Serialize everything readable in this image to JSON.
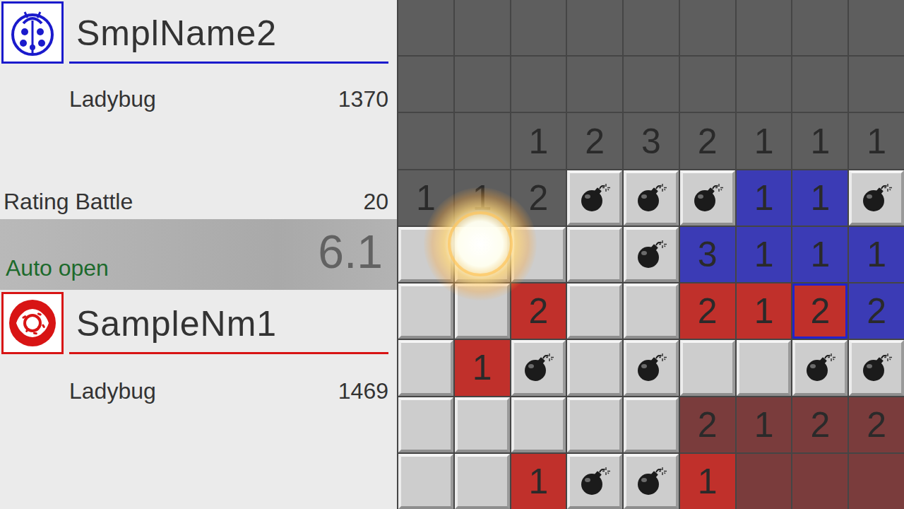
{
  "players": [
    {
      "name": "SmplName2",
      "title": "Ladybug",
      "rating": "1370",
      "color": "#1a1acc",
      "kind": "ladybug"
    },
    {
      "name": "SampleNm1",
      "title": "Ladybug",
      "rating": "1469",
      "color": "#d81414",
      "kind": "donut"
    }
  ],
  "mode": {
    "label": "Rating Battle",
    "value": "20"
  },
  "timer": {
    "value": "6.1"
  },
  "auto_open": {
    "label": "Auto open"
  },
  "board": {
    "rows": [
      [
        {
          "kind": "open",
          "number": "",
          "color": "#5e5e5e",
          "selected": false
        },
        {
          "kind": "open",
          "number": "",
          "color": "#5e5e5e",
          "selected": false
        },
        {
          "kind": "open",
          "number": "",
          "color": "#5e5e5e",
          "selected": false
        },
        {
          "kind": "open",
          "number": "",
          "color": "#5e5e5e",
          "selected": false
        },
        {
          "kind": "open",
          "number": "",
          "color": "#5e5e5e",
          "selected": false
        },
        {
          "kind": "open",
          "number": "",
          "color": "#5e5e5e",
          "selected": false
        },
        {
          "kind": "open",
          "number": "",
          "color": "#5e5e5e",
          "selected": false
        },
        {
          "kind": "open",
          "number": "",
          "color": "#5e5e5e",
          "selected": false
        },
        {
          "kind": "open",
          "number": "",
          "color": "#5e5e5e",
          "selected": false
        }
      ],
      [
        {
          "kind": "open",
          "number": "",
          "color": "#5e5e5e",
          "selected": false
        },
        {
          "kind": "open",
          "number": "",
          "color": "#5e5e5e",
          "selected": false
        },
        {
          "kind": "open",
          "number": "",
          "color": "#5e5e5e",
          "selected": false
        },
        {
          "kind": "open",
          "number": "",
          "color": "#5e5e5e",
          "selected": false
        },
        {
          "kind": "open",
          "number": "",
          "color": "#5e5e5e",
          "selected": false
        },
        {
          "kind": "open",
          "number": "",
          "color": "#5e5e5e",
          "selected": false
        },
        {
          "kind": "open",
          "number": "",
          "color": "#5e5e5e",
          "selected": false
        },
        {
          "kind": "open",
          "number": "",
          "color": "#5e5e5e",
          "selected": false
        },
        {
          "kind": "open",
          "number": "",
          "color": "#5e5e5e",
          "selected": false
        }
      ],
      [
        {
          "kind": "open",
          "number": "",
          "color": "#5e5e5e",
          "selected": false
        },
        {
          "kind": "open",
          "number": "",
          "color": "#5e5e5e",
          "selected": false
        },
        {
          "kind": "open",
          "number": "1",
          "color": "#5e5e5e",
          "selected": false
        },
        {
          "kind": "open",
          "number": "2",
          "color": "#5e5e5e",
          "selected": false
        },
        {
          "kind": "open",
          "number": "3",
          "color": "#5e5e5e",
          "selected": false
        },
        {
          "kind": "open",
          "number": "2",
          "color": "#5e5e5e",
          "selected": false
        },
        {
          "kind": "open",
          "number": "1",
          "color": "#5e5e5e",
          "selected": false
        },
        {
          "kind": "open",
          "number": "1",
          "color": "#5e5e5e",
          "selected": false
        },
        {
          "kind": "open",
          "number": "1",
          "color": "#5e5e5e",
          "selected": false
        }
      ],
      [
        {
          "kind": "open",
          "number": "1",
          "color": "#5e5e5e",
          "selected": false
        },
        {
          "kind": "open",
          "number": "1",
          "color": "#5e5e5e",
          "selected": false
        },
        {
          "kind": "open",
          "number": "2",
          "color": "#5e5e5e",
          "selected": false
        },
        {
          "kind": "mine",
          "selected": false
        },
        {
          "kind": "mine",
          "selected": false
        },
        {
          "kind": "mine",
          "selected": false
        },
        {
          "kind": "open",
          "number": "1",
          "color": "#3b3bb5",
          "selected": false
        },
        {
          "kind": "open",
          "number": "1",
          "color": "#3b3bb5",
          "selected": false
        },
        {
          "kind": "mine",
          "selected": false
        }
      ],
      [
        {
          "kind": "closed",
          "selected": false
        },
        {
          "kind": "closed",
          "selected": false
        },
        {
          "kind": "closed",
          "selected": false
        },
        {
          "kind": "closed",
          "selected": false
        },
        {
          "kind": "mine",
          "selected": false
        },
        {
          "kind": "open",
          "number": "3",
          "color": "#3b3bb5",
          "selected": false
        },
        {
          "kind": "open",
          "number": "1",
          "color": "#3b3bb5",
          "selected": false
        },
        {
          "kind": "open",
          "number": "1",
          "color": "#3b3bb5",
          "selected": false
        },
        {
          "kind": "open",
          "number": "1",
          "color": "#3b3bb5",
          "selected": false
        }
      ],
      [
        {
          "kind": "closed",
          "selected": false
        },
        {
          "kind": "closed",
          "selected": false
        },
        {
          "kind": "open",
          "number": "2",
          "color": "#c0302b",
          "selected": false
        },
        {
          "kind": "closed",
          "selected": false
        },
        {
          "kind": "closed",
          "selected": false
        },
        {
          "kind": "open",
          "number": "2",
          "color": "#c0302b",
          "selected": false
        },
        {
          "kind": "open",
          "number": "1",
          "color": "#c0302b",
          "selected": false
        },
        {
          "kind": "open",
          "number": "2",
          "color": "#c0302b",
          "selected": true
        },
        {
          "kind": "open",
          "number": "2",
          "color": "#3b3bb5",
          "selected": false
        }
      ],
      [
        {
          "kind": "closed",
          "selected": false
        },
        {
          "kind": "open",
          "number": "1",
          "color": "#c0302b",
          "selected": false
        },
        {
          "kind": "mine",
          "selected": false
        },
        {
          "kind": "closed",
          "selected": false
        },
        {
          "kind": "mine",
          "selected": false
        },
        {
          "kind": "closed",
          "selected": false
        },
        {
          "kind": "closed",
          "selected": false
        },
        {
          "kind": "mine",
          "selected": false
        },
        {
          "kind": "mine",
          "selected": false
        }
      ],
      [
        {
          "kind": "closed",
          "selected": false
        },
        {
          "kind": "closed",
          "selected": false
        },
        {
          "kind": "closed",
          "selected": false
        },
        {
          "kind": "closed",
          "selected": false
        },
        {
          "kind": "closed",
          "selected": false
        },
        {
          "kind": "open",
          "number": "2",
          "color": "#7a3c3c",
          "selected": false
        },
        {
          "kind": "open",
          "number": "1",
          "color": "#7a3c3c",
          "selected": false
        },
        {
          "kind": "open",
          "number": "2",
          "color": "#7a3c3c",
          "selected": false
        },
        {
          "kind": "open",
          "number": "2",
          "color": "#7a3c3c",
          "selected": false
        }
      ],
      [
        {
          "kind": "closed",
          "selected": false
        },
        {
          "kind": "closed",
          "selected": false
        },
        {
          "kind": "open",
          "number": "1",
          "color": "#c0302b",
          "selected": false
        },
        {
          "kind": "mine",
          "selected": false
        },
        {
          "kind": "mine",
          "selected": false
        },
        {
          "kind": "open",
          "number": "1",
          "color": "#c0302b",
          "selected": false
        },
        {
          "kind": "open",
          "number": "",
          "color": "#7a3c3c",
          "selected": false
        },
        {
          "kind": "open",
          "number": "",
          "color": "#7a3c3c",
          "selected": false
        },
        {
          "kind": "open",
          "number": "",
          "color": "#7a3c3c",
          "selected": false
        }
      ]
    ]
  }
}
